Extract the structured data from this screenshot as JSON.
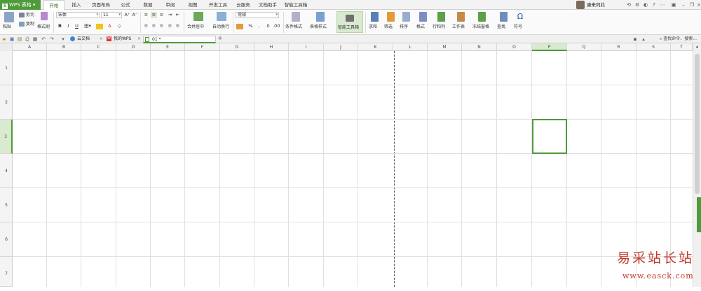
{
  "app": {
    "name": "WPS 表格"
  },
  "menu_tabs": [
    "开始",
    "插入",
    "页面布局",
    "公式",
    "数据",
    "审阅",
    "视图",
    "开发工具",
    "云服务",
    "文档助手",
    "智能工具箱"
  ],
  "active_menu_tab": "开始",
  "user": {
    "name": "康来同此"
  },
  "ribbon": {
    "paste": "粘贴",
    "cut": "剪切",
    "copy": "复制",
    "format_painter": "格式刷",
    "font_name": "宋体",
    "font_size": "11",
    "bold": "B",
    "italic": "I",
    "underline": "U",
    "merge_center": "合并居中",
    "wrap_text": "自动换行",
    "number_format": "常规",
    "percent": "%",
    "cond_format": "条件格式",
    "table_style": "表格样式",
    "smart_toolbox": "智能工具箱",
    "sum": "求和",
    "filter": "筛选",
    "sort": "排序",
    "format": "格式",
    "row_col": "行和列",
    "worksheet": "工作表",
    "freeze": "冻结窗格",
    "find": "查找",
    "symbol": "符号"
  },
  "doc_tabs": [
    {
      "label": "云文档",
      "active": false
    },
    {
      "label": "我的WPS",
      "active": false
    },
    {
      "label": "01 *",
      "active": true
    }
  ],
  "search_command": "查找命令、搜索...",
  "columns": [
    "A",
    "B",
    "C",
    "D",
    "E",
    "F",
    "G",
    "H",
    "I",
    "J",
    "K",
    "L",
    "M",
    "N",
    "O",
    "P",
    "Q",
    "R",
    "S",
    "T"
  ],
  "rows": [
    "1",
    "2",
    "3",
    "4",
    "5",
    "6",
    "7"
  ],
  "selected_cell": {
    "column": "P",
    "row": "3"
  },
  "watermark": {
    "title": "易采站长站",
    "url": "www.easck.com"
  },
  "colors": {
    "accent": "#4f9a3a",
    "selection_fill": "#d9ead0",
    "watermark": "#c23a2c"
  }
}
